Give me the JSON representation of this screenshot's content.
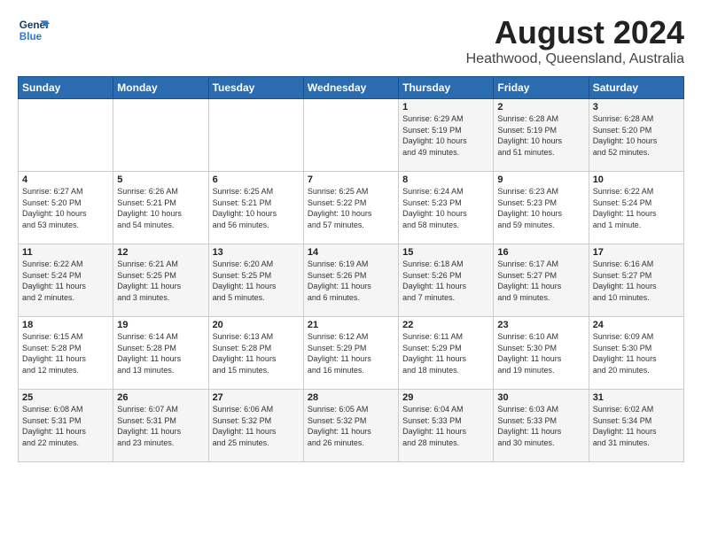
{
  "logo": {
    "line1": "General",
    "line2": "Blue"
  },
  "title": "August 2024",
  "location": "Heathwood, Queensland, Australia",
  "header_days": [
    "Sunday",
    "Monday",
    "Tuesday",
    "Wednesday",
    "Thursday",
    "Friday",
    "Saturday"
  ],
  "weeks": [
    [
      {
        "day": "",
        "info": ""
      },
      {
        "day": "",
        "info": ""
      },
      {
        "day": "",
        "info": ""
      },
      {
        "day": "",
        "info": ""
      },
      {
        "day": "1",
        "info": "Sunrise: 6:29 AM\nSunset: 5:19 PM\nDaylight: 10 hours\nand 49 minutes."
      },
      {
        "day": "2",
        "info": "Sunrise: 6:28 AM\nSunset: 5:19 PM\nDaylight: 10 hours\nand 51 minutes."
      },
      {
        "day": "3",
        "info": "Sunrise: 6:28 AM\nSunset: 5:20 PM\nDaylight: 10 hours\nand 52 minutes."
      }
    ],
    [
      {
        "day": "4",
        "info": "Sunrise: 6:27 AM\nSunset: 5:20 PM\nDaylight: 10 hours\nand 53 minutes."
      },
      {
        "day": "5",
        "info": "Sunrise: 6:26 AM\nSunset: 5:21 PM\nDaylight: 10 hours\nand 54 minutes."
      },
      {
        "day": "6",
        "info": "Sunrise: 6:25 AM\nSunset: 5:21 PM\nDaylight: 10 hours\nand 56 minutes."
      },
      {
        "day": "7",
        "info": "Sunrise: 6:25 AM\nSunset: 5:22 PM\nDaylight: 10 hours\nand 57 minutes."
      },
      {
        "day": "8",
        "info": "Sunrise: 6:24 AM\nSunset: 5:23 PM\nDaylight: 10 hours\nand 58 minutes."
      },
      {
        "day": "9",
        "info": "Sunrise: 6:23 AM\nSunset: 5:23 PM\nDaylight: 10 hours\nand 59 minutes."
      },
      {
        "day": "10",
        "info": "Sunrise: 6:22 AM\nSunset: 5:24 PM\nDaylight: 11 hours\nand 1 minute."
      }
    ],
    [
      {
        "day": "11",
        "info": "Sunrise: 6:22 AM\nSunset: 5:24 PM\nDaylight: 11 hours\nand 2 minutes."
      },
      {
        "day": "12",
        "info": "Sunrise: 6:21 AM\nSunset: 5:25 PM\nDaylight: 11 hours\nand 3 minutes."
      },
      {
        "day": "13",
        "info": "Sunrise: 6:20 AM\nSunset: 5:25 PM\nDaylight: 11 hours\nand 5 minutes."
      },
      {
        "day": "14",
        "info": "Sunrise: 6:19 AM\nSunset: 5:26 PM\nDaylight: 11 hours\nand 6 minutes."
      },
      {
        "day": "15",
        "info": "Sunrise: 6:18 AM\nSunset: 5:26 PM\nDaylight: 11 hours\nand 7 minutes."
      },
      {
        "day": "16",
        "info": "Sunrise: 6:17 AM\nSunset: 5:27 PM\nDaylight: 11 hours\nand 9 minutes."
      },
      {
        "day": "17",
        "info": "Sunrise: 6:16 AM\nSunset: 5:27 PM\nDaylight: 11 hours\nand 10 minutes."
      }
    ],
    [
      {
        "day": "18",
        "info": "Sunrise: 6:15 AM\nSunset: 5:28 PM\nDaylight: 11 hours\nand 12 minutes."
      },
      {
        "day": "19",
        "info": "Sunrise: 6:14 AM\nSunset: 5:28 PM\nDaylight: 11 hours\nand 13 minutes."
      },
      {
        "day": "20",
        "info": "Sunrise: 6:13 AM\nSunset: 5:28 PM\nDaylight: 11 hours\nand 15 minutes."
      },
      {
        "day": "21",
        "info": "Sunrise: 6:12 AM\nSunset: 5:29 PM\nDaylight: 11 hours\nand 16 minutes."
      },
      {
        "day": "22",
        "info": "Sunrise: 6:11 AM\nSunset: 5:29 PM\nDaylight: 11 hours\nand 18 minutes."
      },
      {
        "day": "23",
        "info": "Sunrise: 6:10 AM\nSunset: 5:30 PM\nDaylight: 11 hours\nand 19 minutes."
      },
      {
        "day": "24",
        "info": "Sunrise: 6:09 AM\nSunset: 5:30 PM\nDaylight: 11 hours\nand 20 minutes."
      }
    ],
    [
      {
        "day": "25",
        "info": "Sunrise: 6:08 AM\nSunset: 5:31 PM\nDaylight: 11 hours\nand 22 minutes."
      },
      {
        "day": "26",
        "info": "Sunrise: 6:07 AM\nSunset: 5:31 PM\nDaylight: 11 hours\nand 23 minutes."
      },
      {
        "day": "27",
        "info": "Sunrise: 6:06 AM\nSunset: 5:32 PM\nDaylight: 11 hours\nand 25 minutes."
      },
      {
        "day": "28",
        "info": "Sunrise: 6:05 AM\nSunset: 5:32 PM\nDaylight: 11 hours\nand 26 minutes."
      },
      {
        "day": "29",
        "info": "Sunrise: 6:04 AM\nSunset: 5:33 PM\nDaylight: 11 hours\nand 28 minutes."
      },
      {
        "day": "30",
        "info": "Sunrise: 6:03 AM\nSunset: 5:33 PM\nDaylight: 11 hours\nand 30 minutes."
      },
      {
        "day": "31",
        "info": "Sunrise: 6:02 AM\nSunset: 5:34 PM\nDaylight: 11 hours\nand 31 minutes."
      }
    ]
  ]
}
